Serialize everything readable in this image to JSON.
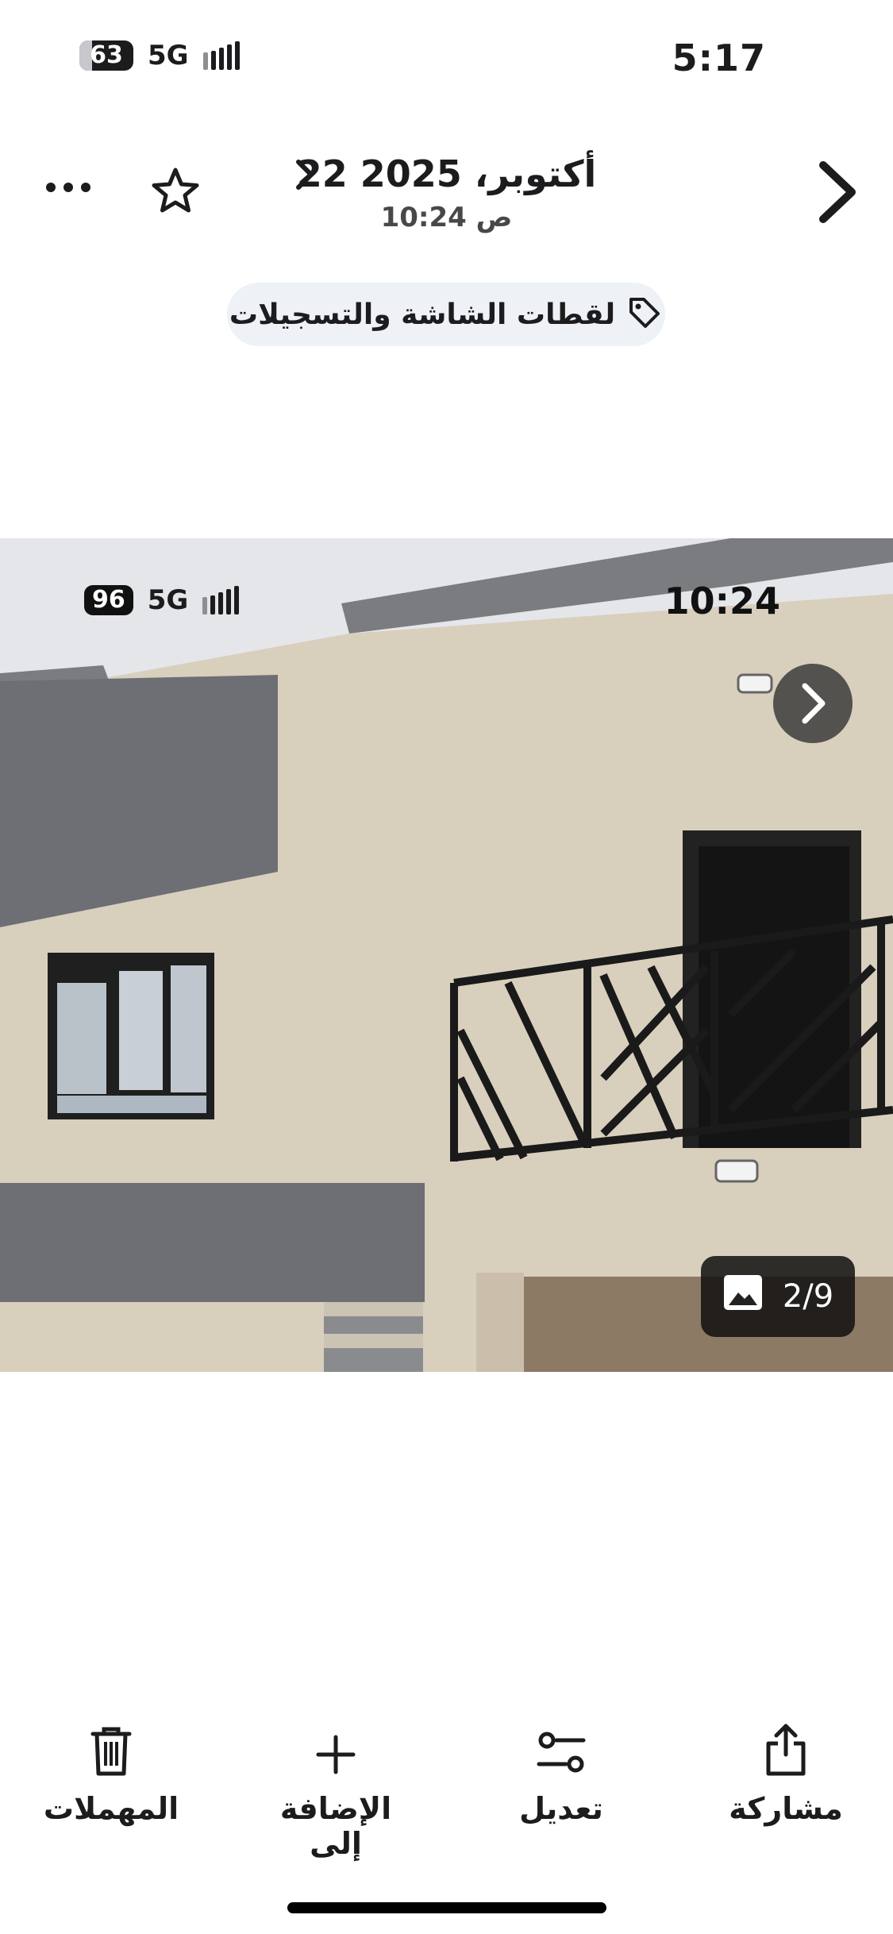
{
  "status_bar": {
    "time": "5:17",
    "network": "5G",
    "battery": "63"
  },
  "header": {
    "date": "22 أكتوبر، 2025",
    "time": "10:24 ص",
    "back_icon": "chevron-right-icon",
    "star_icon": "star-icon",
    "more_icon": "ellipsis-icon"
  },
  "tag_chip": {
    "label": "لقطات الشاشة والتسجيلات",
    "icon": "tag-icon"
  },
  "photo": {
    "status_time": "10:24",
    "status_network": "5G",
    "status_battery": "96",
    "counter": "2/9"
  },
  "toolbar": {
    "share_label": "مشاركة",
    "edit_label": "تعديل",
    "add_to_label": "الإضافة إلى",
    "trash_label": "المهملات"
  },
  "colors": {
    "accent": "#1c1c1e",
    "chip_bg": "#eef1f5",
    "wall": "#d9cfbd",
    "gray_panel": "#6e6f74"
  }
}
